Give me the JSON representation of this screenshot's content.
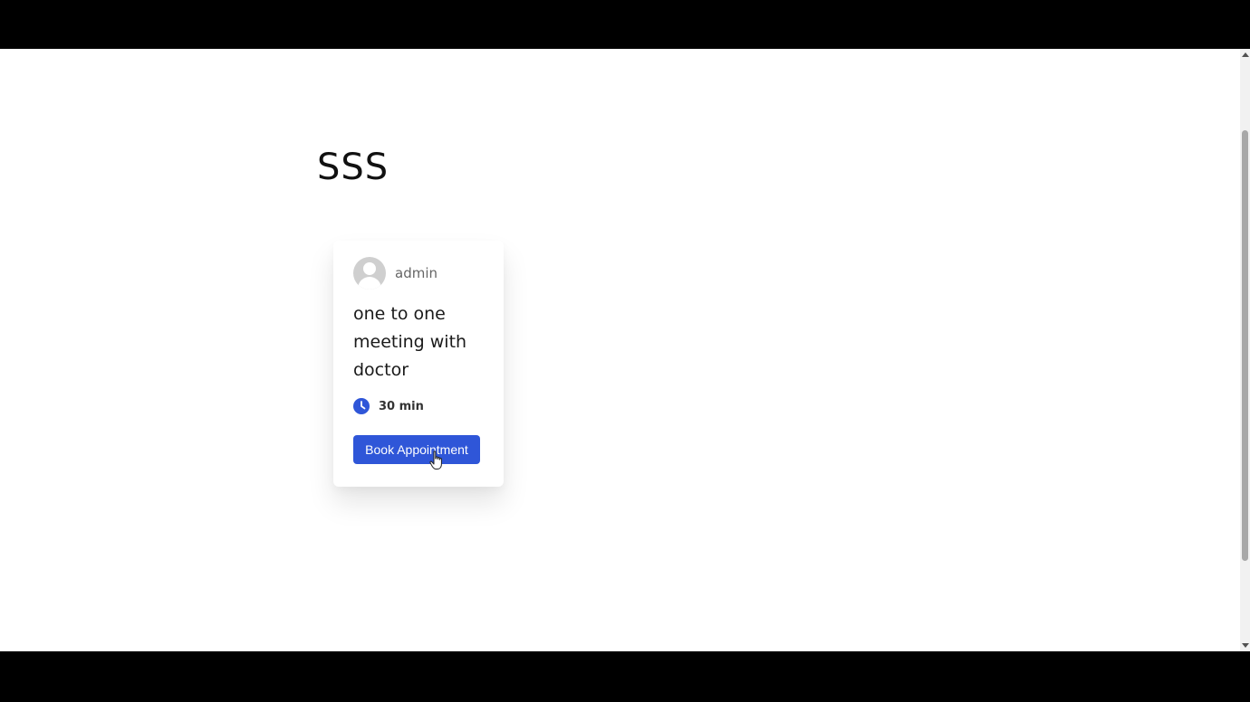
{
  "page": {
    "title": "SSS"
  },
  "event_card": {
    "author_name": "admin",
    "title": "one to one meeting with doctor",
    "duration": "30 min",
    "book_label": "Book Appointment"
  },
  "icons": {
    "avatar": "user-avatar-placeholder-icon",
    "duration": "clock-icon",
    "cursor": "hand-pointer-icon"
  },
  "colors": {
    "accent": "#2f56d8",
    "page_background": "#ffffff",
    "letterbox": "#000000"
  }
}
